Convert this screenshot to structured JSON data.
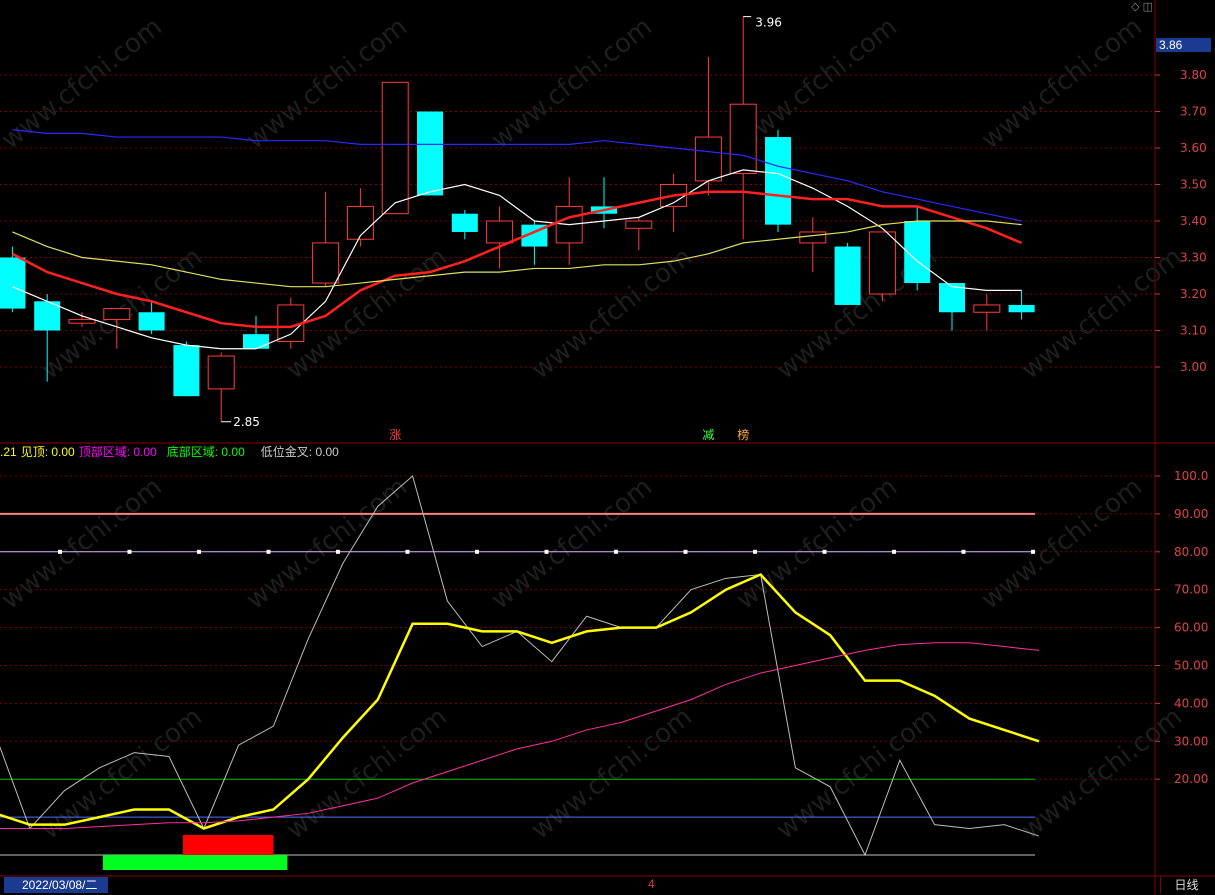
{
  "header": {
    "current_price": "3.86",
    "date_label": "2022/03/08/二",
    "period_label": "日线",
    "bottom_marker": "4",
    "corner_icons": "◇ ◫"
  },
  "indicator_header": {
    "items": [
      {
        "label": ".21",
        "color": "#ffff00"
      },
      {
        "label": "见顶: 0.00",
        "color": "#ffff00"
      },
      {
        "label": "顶部区域: 0.00",
        "color": "#ff00ff"
      },
      {
        "label": "底部区域: 0.00",
        "color": "#00ff00"
      },
      {
        "label": "低位金叉: 0.00",
        "color": "#cccccc"
      }
    ]
  },
  "markers": [
    {
      "text": "涨",
      "color": "#ff4040",
      "index": 11
    },
    {
      "text": "减",
      "color": "#40ff40",
      "index": 20
    },
    {
      "text": "榜",
      "color": "#ffaa40",
      "index": 21
    }
  ],
  "price_annotations": {
    "high": "3.96",
    "low": "2.85"
  },
  "colors": {
    "up_candle": "#ff3b3b",
    "down_candle": "#00ffff",
    "ma5": "#ffffff",
    "ma10": "#ff2020",
    "ma20": "#e0e060",
    "ma60": "#2a2aff",
    "grid": "#800000",
    "k_line": "#ffff00",
    "d_line": "#ff2f9e",
    "j_line": "#bdbdbd"
  },
  "chart_data": [
    {
      "type": "candlestick",
      "ylim": [
        2.82,
        3.96
      ],
      "yticks": [
        "3.80",
        "3.70",
        "3.60",
        "3.50",
        "3.40",
        "3.30",
        "3.20",
        "3.10",
        "3.00"
      ],
      "candles": [
        {
          "o": 3.3,
          "h": 3.33,
          "l": 3.15,
          "c": 3.16
        },
        {
          "o": 3.18,
          "h": 3.2,
          "l": 2.96,
          "c": 3.1
        },
        {
          "o": 3.12,
          "h": 3.15,
          "l": 3.11,
          "c": 3.13
        },
        {
          "o": 3.13,
          "h": 3.16,
          "l": 3.05,
          "c": 3.16
        },
        {
          "o": 3.15,
          "h": 3.18,
          "l": 3.09,
          "c": 3.1
        },
        {
          "o": 3.06,
          "h": 3.07,
          "l": 2.92,
          "c": 2.92
        },
        {
          "o": 2.94,
          "h": 3.04,
          "l": 2.85,
          "c": 3.03
        },
        {
          "o": 3.09,
          "h": 3.14,
          "l": 3.05,
          "c": 3.05
        },
        {
          "o": 3.07,
          "h": 3.19,
          "l": 3.05,
          "c": 3.17
        },
        {
          "o": 3.23,
          "h": 3.48,
          "l": 3.22,
          "c": 3.34
        },
        {
          "o": 3.35,
          "h": 3.49,
          "l": 3.33,
          "c": 3.44
        },
        {
          "o": 3.42,
          "h": 3.78,
          "l": 3.42,
          "c": 3.78
        },
        {
          "o": 3.7,
          "h": 3.7,
          "l": 3.47,
          "c": 3.47
        },
        {
          "o": 3.42,
          "h": 3.43,
          "l": 3.35,
          "c": 3.37
        },
        {
          "o": 3.34,
          "h": 3.44,
          "l": 3.27,
          "c": 3.4
        },
        {
          "o": 3.39,
          "h": 3.4,
          "l": 3.28,
          "c": 3.33
        },
        {
          "o": 3.34,
          "h": 3.52,
          "l": 3.28,
          "c": 3.44
        },
        {
          "o": 3.44,
          "h": 3.52,
          "l": 3.38,
          "c": 3.42
        },
        {
          "o": 3.38,
          "h": 3.41,
          "l": 3.32,
          "c": 3.4
        },
        {
          "o": 3.44,
          "h": 3.53,
          "l": 3.37,
          "c": 3.5
        },
        {
          "o": 3.51,
          "h": 3.85,
          "l": 3.47,
          "c": 3.63
        },
        {
          "o": 3.53,
          "h": 3.96,
          "l": 3.35,
          "c": 3.72
        },
        {
          "o": 3.63,
          "h": 3.65,
          "l": 3.37,
          "c": 3.39
        },
        {
          "o": 3.34,
          "h": 3.41,
          "l": 3.26,
          "c": 3.37
        },
        {
          "o": 3.33,
          "h": 3.34,
          "l": 3.17,
          "c": 3.17
        },
        {
          "o": 3.2,
          "h": 3.37,
          "l": 3.18,
          "c": 3.37
        },
        {
          "o": 3.4,
          "h": 3.44,
          "l": 3.21,
          "c": 3.23
        },
        {
          "o": 3.23,
          "h": 3.23,
          "l": 3.1,
          "c": 3.15
        },
        {
          "o": 3.15,
          "h": 3.2,
          "l": 3.1,
          "c": 3.17
        },
        {
          "o": 3.17,
          "h": 3.21,
          "l": 3.13,
          "c": 3.15
        }
      ],
      "series": [
        {
          "key": "ma5",
          "values": [
            3.22,
            3.18,
            3.14,
            3.11,
            3.08,
            3.06,
            3.05,
            3.05,
            3.09,
            3.18,
            3.36,
            3.45,
            3.48,
            3.5,
            3.47,
            3.4,
            3.39,
            3.4,
            3.41,
            3.45,
            3.51,
            3.54,
            3.53,
            3.49,
            3.44,
            3.38,
            3.29,
            3.22,
            3.21,
            3.21
          ]
        },
        {
          "key": "ma10",
          "values": [
            3.31,
            3.26,
            3.23,
            3.2,
            3.18,
            3.15,
            3.12,
            3.11,
            3.11,
            3.14,
            3.21,
            3.25,
            3.26,
            3.29,
            3.33,
            3.37,
            3.41,
            3.43,
            3.45,
            3.47,
            3.48,
            3.48,
            3.47,
            3.46,
            3.46,
            3.44,
            3.44,
            3.41,
            3.38,
            3.34
          ]
        },
        {
          "key": "ma20",
          "values": [
            3.37,
            3.33,
            3.3,
            3.29,
            3.28,
            3.26,
            3.24,
            3.23,
            3.22,
            3.22,
            3.23,
            3.24,
            3.25,
            3.26,
            3.26,
            3.27,
            3.27,
            3.28,
            3.28,
            3.29,
            3.31,
            3.34,
            3.35,
            3.36,
            3.37,
            3.39,
            3.4,
            3.4,
            3.4,
            3.39
          ]
        },
        {
          "key": "ma60",
          "values": [
            3.65,
            3.64,
            3.64,
            3.63,
            3.63,
            3.63,
            3.63,
            3.62,
            3.62,
            3.62,
            3.61,
            3.61,
            3.61,
            3.61,
            3.61,
            3.61,
            3.61,
            3.62,
            3.61,
            3.6,
            3.59,
            3.58,
            3.55,
            3.53,
            3.51,
            3.48,
            3.46,
            3.44,
            3.42,
            3.4
          ]
        }
      ]
    },
    {
      "type": "line",
      "ylim": [
        -10,
        105
      ],
      "yticks": [
        "100.0",
        "90.00",
        "80.00",
        "70.00",
        "60.00",
        "50.00",
        "40.00",
        "30.00",
        "20.00"
      ],
      "hlines": [
        {
          "value": 90,
          "color": "#ff8080"
        },
        {
          "value": 80,
          "color": "#d6b8ff",
          "dots": true
        },
        {
          "value": 20,
          "color": "#00c000"
        },
        {
          "value": 10,
          "color": "#4f6fff"
        },
        {
          "value": 0,
          "color": "#c0c0c0"
        }
      ],
      "bars": [
        {
          "from": 3.1,
          "to": 8.4,
          "color": "#00ff20",
          "value": -3
        },
        {
          "from": 5.4,
          "to": 8.0,
          "color": "#ff0000",
          "value": 2.5
        }
      ],
      "series": [
        {
          "key": "j_line",
          "values": [
            32,
            7,
            17,
            23,
            27,
            26,
            7,
            29,
            34,
            57,
            77,
            92,
            100,
            67,
            55,
            59,
            51,
            63,
            60,
            60,
            70,
            73,
            74,
            23,
            18,
            0,
            25,
            8,
            7,
            8,
            5
          ]
        },
        {
          "key": "k_line",
          "values": [
            11,
            8,
            8,
            10,
            12,
            12,
            7,
            10,
            12,
            20,
            31,
            41,
            61,
            61,
            59,
            59,
            56,
            59,
            60,
            60,
            64,
            70,
            74,
            64,
            58,
            46,
            46,
            42,
            36,
            33,
            30
          ]
        },
        {
          "key": "d_line",
          "values": [
            7,
            7,
            7,
            7.5,
            8,
            8.5,
            8.5,
            9,
            10,
            11,
            13,
            15,
            19,
            22,
            25,
            28,
            30,
            33,
            35,
            38,
            41,
            45,
            48,
            50,
            52,
            54,
            55.5,
            56,
            56,
            55,
            54
          ]
        }
      ]
    }
  ]
}
